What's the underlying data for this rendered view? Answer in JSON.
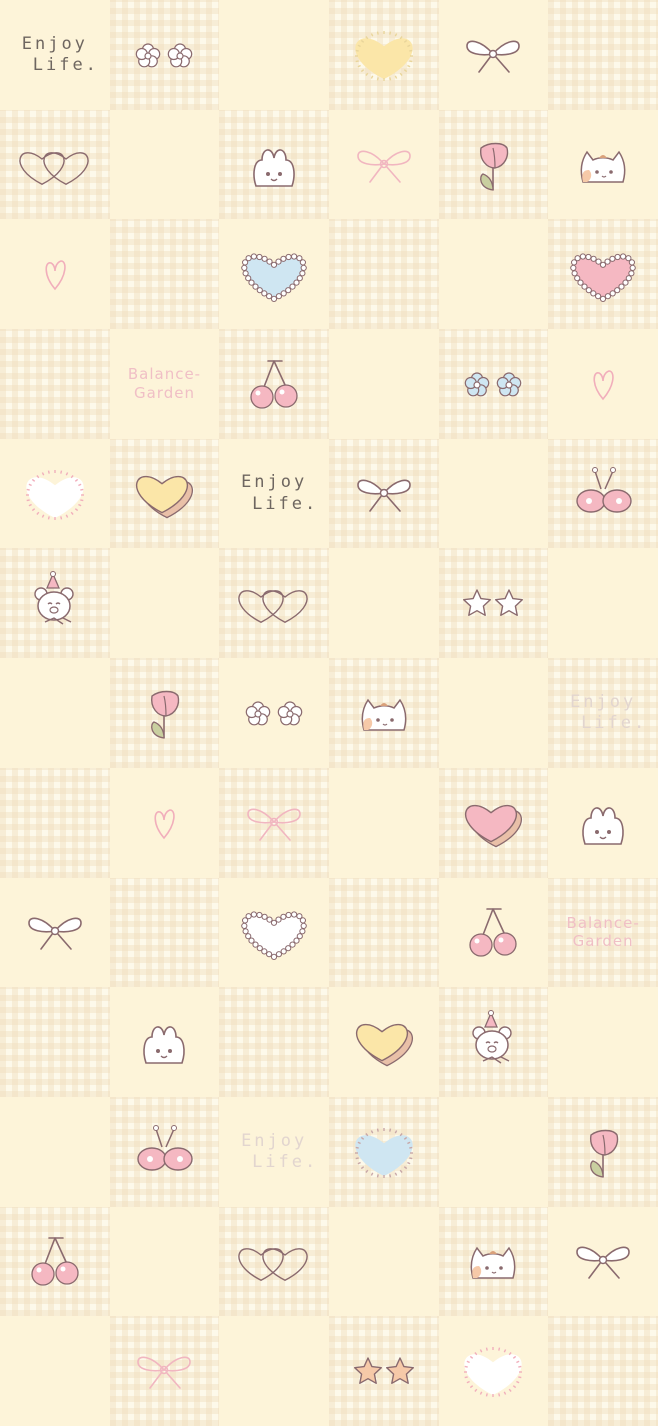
{
  "wallpaper": {
    "description_texts": {
      "enjoy_line1": "Enjoy",
      "enjoy_line2": "Life.",
      "balance_line1": "Balance-",
      "balance_line2": "Garden"
    },
    "colors": {
      "cream": "#fdf4d9",
      "pink": "#f5b8c2",
      "outline": "#8a6a6e",
      "yellow": "#fbe6a8",
      "blue": "#cfe6f2",
      "peach": "#f6c9a8"
    },
    "tiles": [
      "text-enjoy",
      "flowers",
      "blank",
      "heart-yellow-glow",
      "bow-outline",
      "blank",
      "double-heart",
      "blank",
      "bunny-face",
      "bow-pink",
      "tulip",
      "cat-face",
      "heart-small-pink",
      "blank",
      "pearl-heart-blue",
      "blank",
      "blank",
      "pearl-heart-pink",
      "blank",
      "text-balance",
      "cherries",
      "blank",
      "flowers-blue",
      "heart-small-pink",
      "heart-white-glow",
      "heart-yellow-3d",
      "text-enjoy",
      "bow-outline",
      "blank",
      "butterfly",
      "bear",
      "blank",
      "double-heart",
      "blank",
      "stars-outline",
      "blank",
      "blank",
      "tulip",
      "flowers",
      "cat-face",
      "blank",
      "text-enjoy-faded",
      "blank",
      "heart-small-pink",
      "bow-pink",
      "blank",
      "heart-pink-3d",
      "bunny-face",
      "bow-outline",
      "blank",
      "pearl-heart-white",
      "blank",
      "cherries",
      "text-balance",
      "blank",
      "bunny-face",
      "blank",
      "heart-yellow-3d",
      "bear",
      "blank",
      "blank",
      "butterfly",
      "text-enjoy-faded",
      "heart-blue-glow",
      "blank",
      "tulip",
      "cherries",
      "blank",
      "double-heart",
      "blank",
      "cat-face",
      "bow-outline",
      "blank",
      "bow-pink",
      "blank",
      "stars-peach",
      "heart-white-glow",
      "blank"
    ]
  }
}
